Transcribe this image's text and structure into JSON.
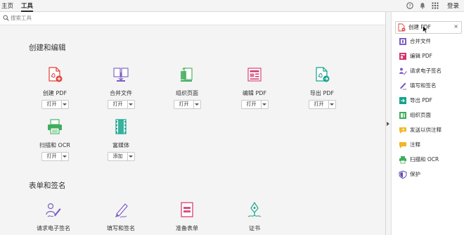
{
  "nav": {
    "tabs": [
      {
        "label": "主页"
      },
      {
        "label": "工具"
      }
    ],
    "login": "登录"
  },
  "search": {
    "placeholder": "搜索工具"
  },
  "sections": [
    {
      "title": "创建和编辑",
      "tools": [
        {
          "label": "创建 PDF",
          "button": "打开"
        },
        {
          "label": "合并文件",
          "button": "打开"
        },
        {
          "label": "组织页面",
          "button": "打开"
        },
        {
          "label": "编辑 PDF",
          "button": "打开"
        },
        {
          "label": "导出 PDF",
          "button": "打开"
        },
        {
          "label": "扫描和 OCR",
          "button": "打开"
        },
        {
          "label": "富媒体",
          "button": "添加"
        }
      ]
    },
    {
      "title": "表单和签名",
      "tools": [
        {
          "label": "请求电子签名"
        },
        {
          "label": "填写和签名"
        },
        {
          "label": "准备表单"
        },
        {
          "label": "证书"
        }
      ]
    }
  ],
  "right_panel": {
    "items": [
      {
        "label": "创建 PDF",
        "close": "×"
      },
      {
        "label": "合并文件"
      },
      {
        "label": "编辑 PDF"
      },
      {
        "label": "请求电子签名"
      },
      {
        "label": "填写和签名"
      },
      {
        "label": "导出 PDF"
      },
      {
        "label": "组织页面"
      },
      {
        "label": "发送以供注释"
      },
      {
        "label": "注释"
      },
      {
        "label": "扫描和 OCR"
      },
      {
        "label": "保护"
      }
    ]
  },
  "colors": {
    "red": "#e0413a",
    "purple": "#7b5cc4",
    "green": "#3fae5a",
    "pink": "#d6336c",
    "teal": "#15a38c",
    "yellow": "#f1b724"
  }
}
